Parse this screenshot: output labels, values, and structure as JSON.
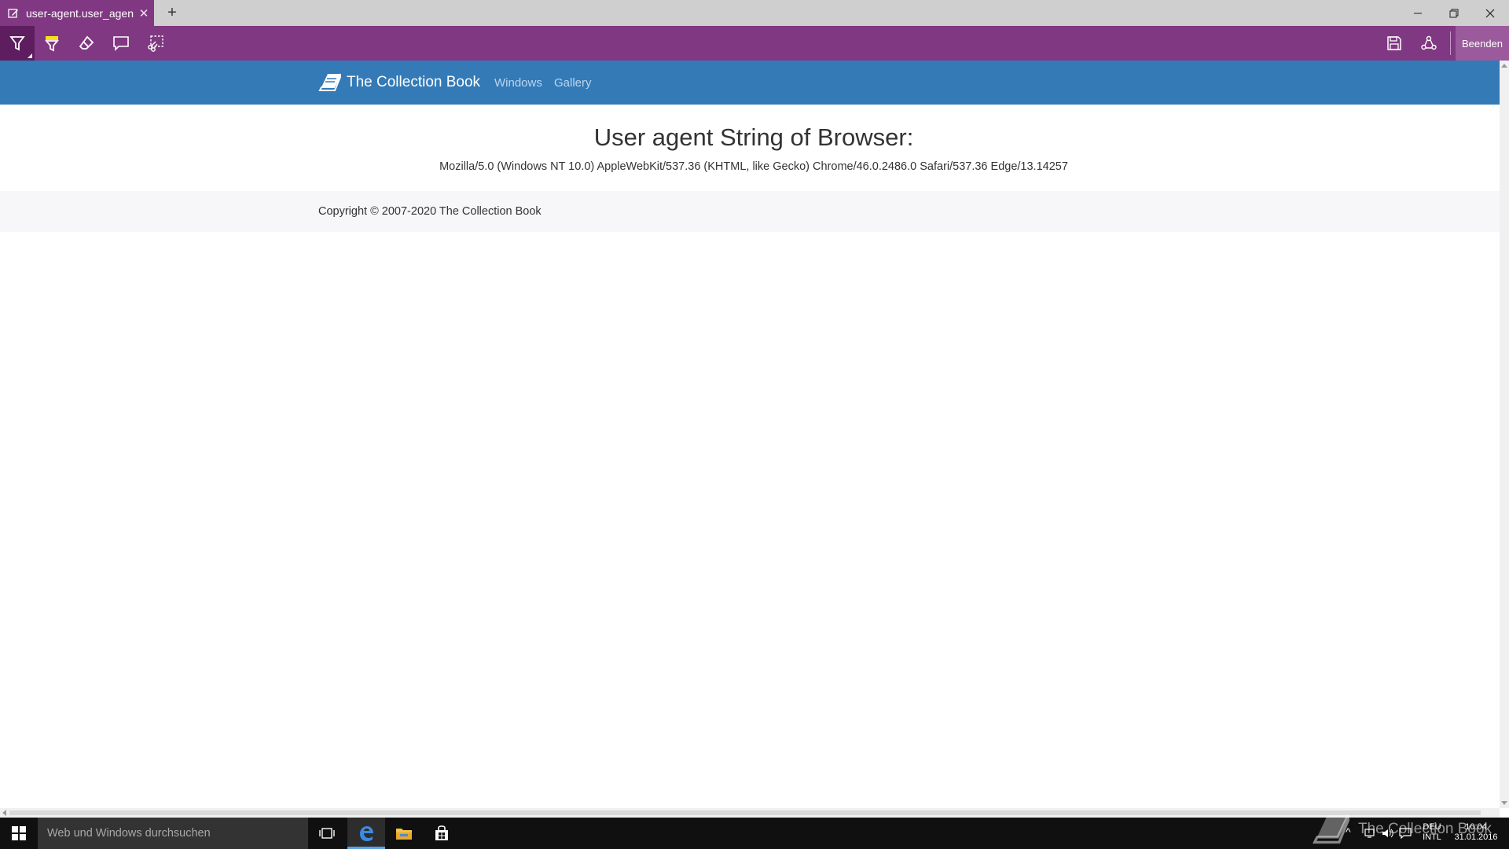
{
  "browser": {
    "tab_title": "user-agent.user_agent -",
    "tab_close_glyph": "✕",
    "new_tab_glyph": "+",
    "exit_label": "Beenden",
    "colors": {
      "accent": "#813882",
      "active_tool": "#5d1d5e"
    },
    "ink_tools": [
      "pen-icon",
      "highlighter-icon",
      "eraser-icon",
      "comment-icon",
      "clip-icon"
    ],
    "ink_actions": [
      "save-icon",
      "share-icon"
    ]
  },
  "site": {
    "brand": "The Collection Book",
    "nav": [
      {
        "label": "Windows"
      },
      {
        "label": "Gallery"
      }
    ],
    "colors": {
      "navbar": "#337ab7",
      "footer": "#f7f7f9"
    }
  },
  "main": {
    "title": "User agent String of Browser:",
    "ua_string": "Mozilla/5.0 (Windows NT 10.0) AppleWebKit/537.36 (KHTML, like Gecko) Chrome/46.0.2486.0 Safari/537.36 Edge/13.14257"
  },
  "footer": {
    "copyright": "Copyright © 2007-2020 The Collection Book"
  },
  "taskbar": {
    "search_placeholder": "Web und Windows durchsuchen",
    "language_top": "DEU",
    "language_bottom": "INTL",
    "time": "10:04",
    "date": "31.01.2016",
    "watermark": "The Collection Book"
  }
}
